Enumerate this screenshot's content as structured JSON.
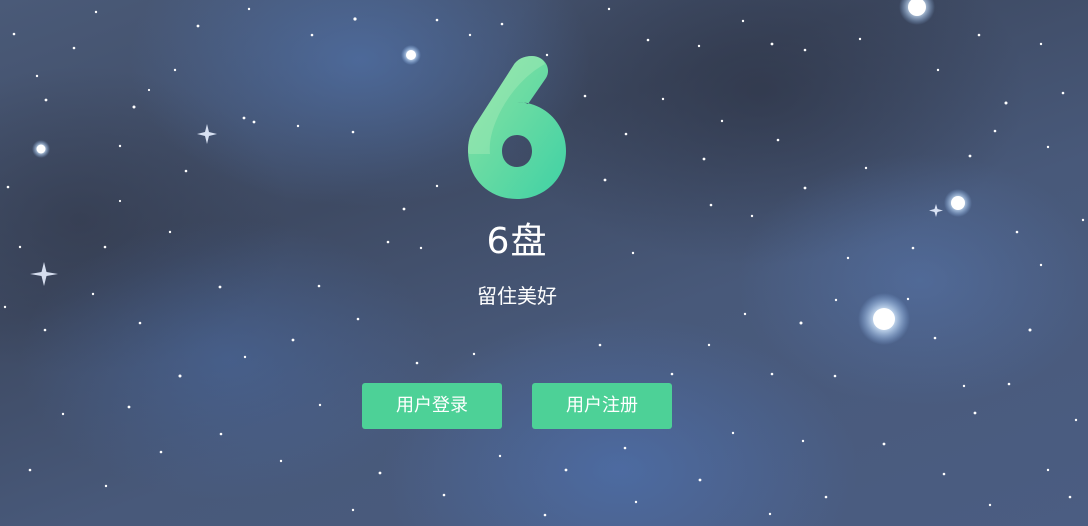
{
  "app": {
    "logo_icon": "six-logo-icon",
    "title": "6盘",
    "slogan": "留住美好"
  },
  "actions": {
    "login_label": "用户登录",
    "register_label": "用户注册"
  },
  "colors": {
    "accent": "#4dd197",
    "logo_light": "#7ee0a3",
    "logo_dark": "#3fd1a4",
    "text": "#ffffff"
  }
}
